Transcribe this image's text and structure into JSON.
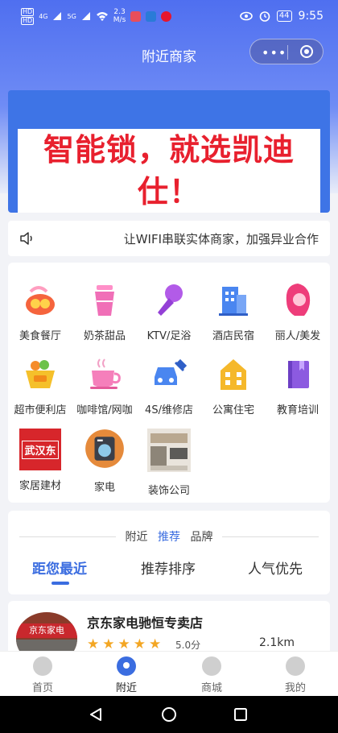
{
  "status_bar": {
    "hd_top": "HD",
    "hd_bottom": "HD",
    "sig1": "4G",
    "sig2": "5G",
    "speed_value": "2.3",
    "speed_unit": "M/s",
    "battery": "44",
    "time": "9:55"
  },
  "nav": {
    "title": "附近商家",
    "capsule_dots": "•••"
  },
  "banner": {
    "text": "智能锁，就选凯迪仕！"
  },
  "notice": {
    "text": "让WIFI串联实体商家，加强异业合作"
  },
  "categories": [
    {
      "label": "美食餐厅",
      "icon": "food-icon"
    },
    {
      "label": "奶茶甜品",
      "icon": "milk-tea-icon"
    },
    {
      "label": "KTV/足浴",
      "icon": "microphone-icon"
    },
    {
      "label": "酒店民宿",
      "icon": "hotel-icon"
    },
    {
      "label": "丽人/美发",
      "icon": "beauty-icon"
    },
    {
      "label": "超市便利店",
      "icon": "supermarket-icon"
    },
    {
      "label": "咖啡馆/网咖",
      "icon": "coffee-icon"
    },
    {
      "label": "4S/维修店",
      "icon": "car-repair-icon"
    },
    {
      "label": "公寓住宅",
      "icon": "apartment-icon"
    },
    {
      "label": "教育培训",
      "icon": "book-icon"
    },
    {
      "label": "家居建材",
      "icon": "home-building-logo"
    },
    {
      "label": "家电",
      "icon": "appliance-icon"
    },
    {
      "label": "装饰公司",
      "icon": "decoration-photo"
    }
  ],
  "logo_text": "武汉东",
  "filter": {
    "mini_tabs": [
      "附近",
      "推荐",
      "品牌"
    ],
    "active_mini": "推荐",
    "sort_tabs": [
      "距您最近",
      "推荐排序",
      "人气优先"
    ],
    "active_sort": "距您最近"
  },
  "shop": {
    "name": "京东家电驰恒专卖店",
    "rating": 5,
    "score": "5.0分",
    "distance": "2.1km",
    "sign_text": "京东家电"
  },
  "tabbar": [
    {
      "label": "首页",
      "icon": "home-icon",
      "active": false
    },
    {
      "label": "附近",
      "icon": "location-icon",
      "active": true
    },
    {
      "label": "商城",
      "icon": "mall-icon",
      "active": false
    },
    {
      "label": "我的",
      "icon": "profile-icon",
      "active": false
    }
  ],
  "colors": {
    "accent": "#3b6de0",
    "banner_bg": "#3e74e6",
    "banner_text": "#e8202e",
    "star": "#f3a623"
  }
}
